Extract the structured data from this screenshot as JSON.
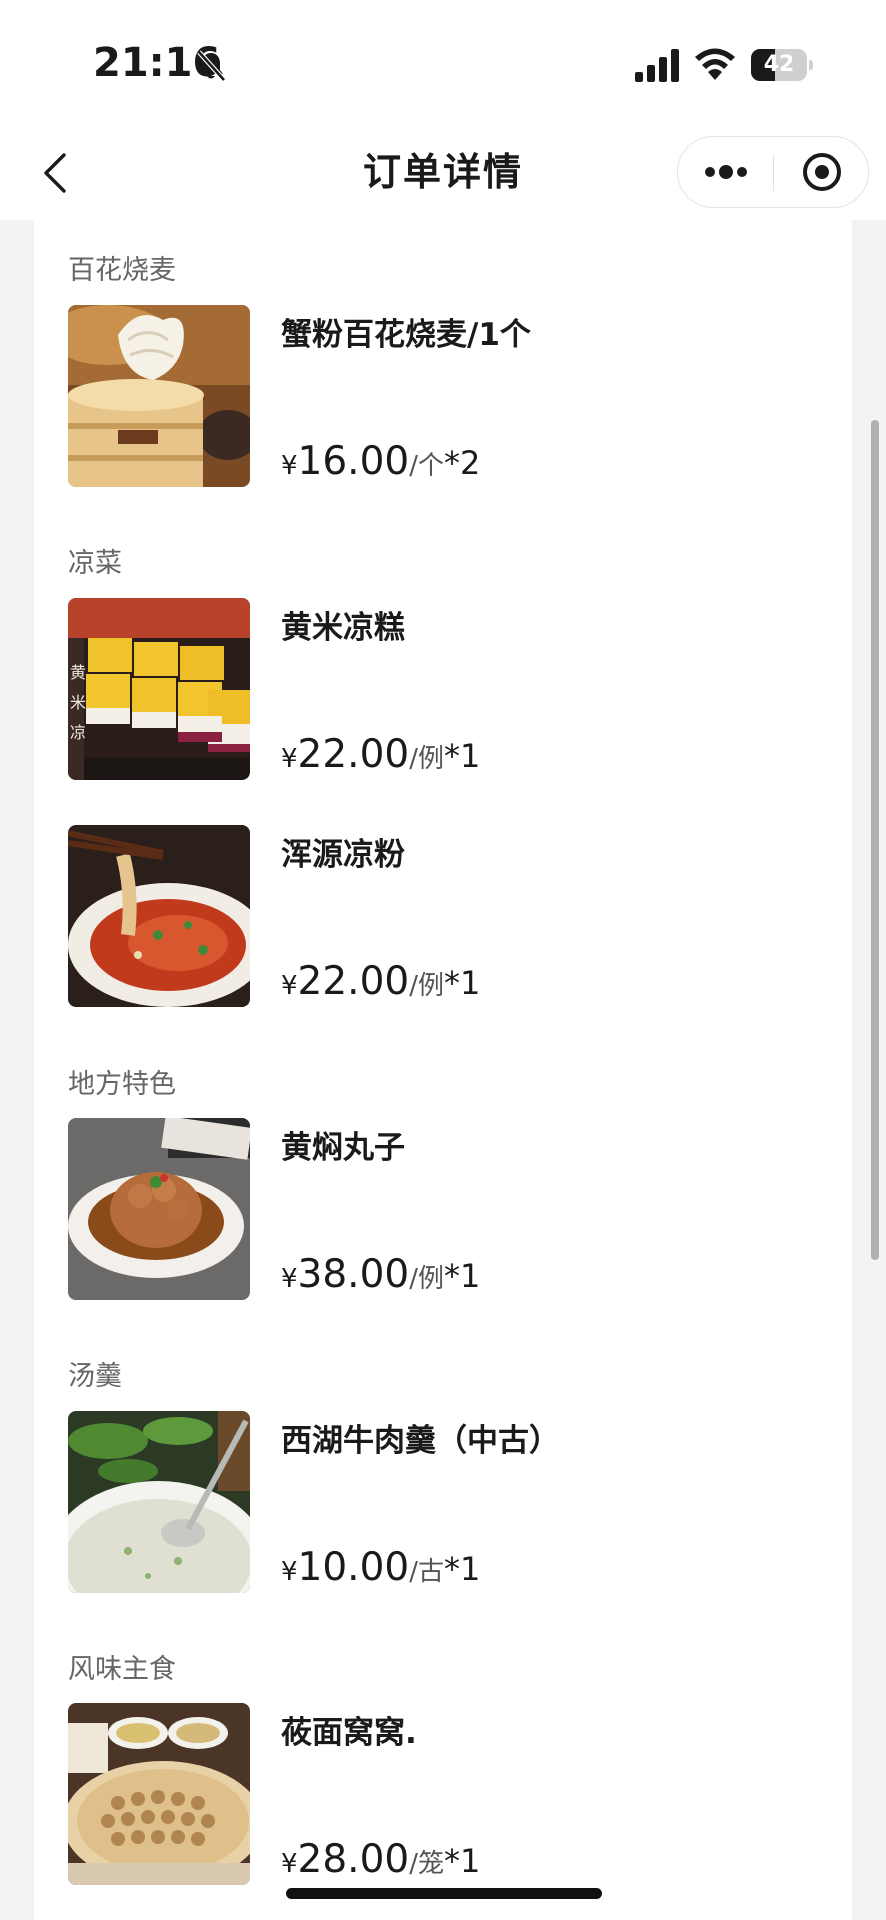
{
  "status_bar": {
    "time": "21:16",
    "battery_level": "42",
    "battery_fraction": 0.42,
    "icons": [
      "bell-off-icon",
      "signal-icon",
      "wifi-icon",
      "battery-icon"
    ]
  },
  "nav": {
    "title": "订单详情",
    "back_icon": "chevron-left-icon",
    "more_icon": "more-dots-icon",
    "close_icon": "target-circle-icon"
  },
  "sections": [
    {
      "title": "百花烧麦",
      "items": [
        {
          "name": "蟹粉百花烧麦/1个",
          "currency": "¥",
          "price": "16.00",
          "unit": "/个",
          "qty": "*2"
        }
      ]
    },
    {
      "title": "凉菜",
      "items": [
        {
          "name": "黄米凉糕",
          "currency": "¥",
          "price": "22.00",
          "unit": "/例",
          "qty": "*1"
        },
        {
          "name": "浑源凉粉",
          "currency": "¥",
          "price": "22.00",
          "unit": "/例",
          "qty": "*1"
        }
      ]
    },
    {
      "title": "地方特色",
      "items": [
        {
          "name": "黄焖丸子",
          "currency": "¥",
          "price": "38.00",
          "unit": "/例",
          "qty": "*1"
        }
      ]
    },
    {
      "title": "汤羹",
      "items": [
        {
          "name": "西湖牛肉羹（中古）",
          "currency": "¥",
          "price": "10.00",
          "unit": "/古",
          "qty": "*1"
        }
      ]
    },
    {
      "title": "风味主食",
      "items": [
        {
          "name": "莜面窝窝.",
          "currency": "¥",
          "price": "28.00",
          "unit": "/笼",
          "qty": "*1"
        }
      ]
    }
  ],
  "colors": {
    "background": "#f3f3f3",
    "card": "#ffffff",
    "text": "#1a1a1a",
    "section_title": "#666666"
  }
}
